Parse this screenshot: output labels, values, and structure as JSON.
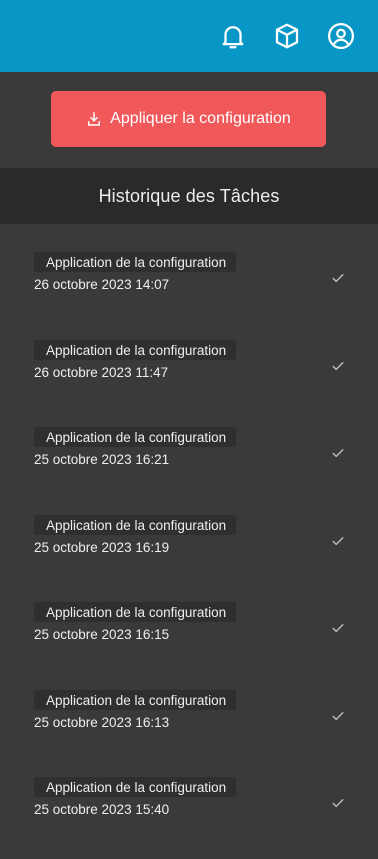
{
  "topbar": {
    "icons": [
      "bell-icon",
      "box-icon",
      "user-icon"
    ]
  },
  "apply_button": {
    "label": "Appliquer la configuration",
    "icon": "download-icon"
  },
  "history": {
    "title": "Historique des Tâches",
    "tasks": [
      {
        "title": "Application de la configuration",
        "date": "26 octobre 2023 14:07",
        "status_icon": "check-icon"
      },
      {
        "title": "Application de la configuration",
        "date": "26 octobre 2023 11:47",
        "status_icon": "check-icon"
      },
      {
        "title": "Application de la configuration",
        "date": "25 octobre 2023 16:21",
        "status_icon": "check-icon"
      },
      {
        "title": "Application de la configuration",
        "date": "25 octobre 2023 16:19",
        "status_icon": "check-icon"
      },
      {
        "title": "Application de la configuration",
        "date": "25 octobre 2023 16:15",
        "status_icon": "check-icon"
      },
      {
        "title": "Application de la configuration",
        "date": "25 octobre 2023 16:13",
        "status_icon": "check-icon"
      },
      {
        "title": "Application de la configuration",
        "date": "25 octobre 2023 15:40",
        "status_icon": "check-icon"
      }
    ]
  },
  "colors": {
    "topbar": "#0896c6",
    "apply_button": "#f0585a",
    "panel": "#3a3a3a",
    "header": "#2a2a2a"
  }
}
